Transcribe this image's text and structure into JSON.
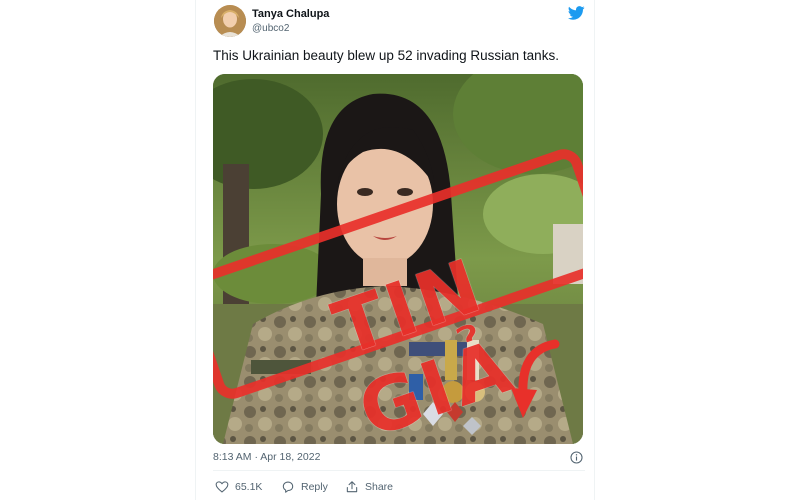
{
  "tweet": {
    "author_name": "Tanya Chalupa",
    "author_handle": "@ubco2",
    "text": "This Ukrainian beauty blew up 52 invading Russian tanks.",
    "timestamp": "8:13 AM · Apr 18, 2022",
    "avatar_icon": "avatar-photo",
    "logo_icon": "twitter-bird-icon",
    "brand_color": "#1d9bf0"
  },
  "media": {
    "stamp_text": "TIN GIẢ",
    "stamp_color": "#e8302a",
    "arrow_color": "#e8302a"
  },
  "actions": {
    "likes_count": "65.1K",
    "reply_label": "Reply",
    "share_label": "Share",
    "icons": [
      "heart-icon",
      "reply-bubble-icon",
      "share-icon",
      "info-icon"
    ]
  }
}
